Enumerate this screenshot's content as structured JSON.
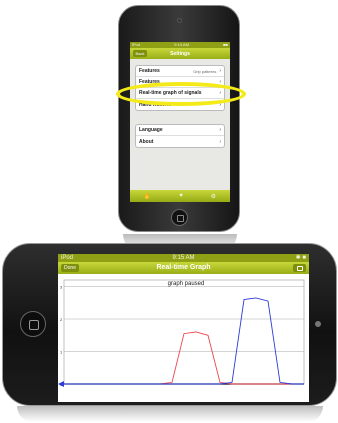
{
  "portrait": {
    "status": {
      "carrier": "iPod",
      "time": "9:14 AM",
      "battery": "■■"
    },
    "navbar": {
      "back": "Back",
      "title": "Settings"
    },
    "group1": [
      {
        "label": "Features",
        "detail": "Grip patterns"
      },
      {
        "label": "Features",
        "detail": ""
      },
      {
        "label": "Real-time graph of signals",
        "detail": ""
      },
      {
        "label": "Hand Actions",
        "detail": ""
      }
    ],
    "group2": [
      {
        "label": "Language",
        "detail": ""
      },
      {
        "label": "About",
        "detail": ""
      }
    ],
    "tabs": [
      "✋",
      "♥",
      "⚙"
    ]
  },
  "landscape": {
    "status": {
      "carrier": "iPod",
      "time": "9:15 AM",
      "battery": "✱ ■"
    },
    "navbar": {
      "done": "Done",
      "title": "Real-time Graph"
    },
    "graph": {
      "annotation": "graph paused",
      "y_ticks": [
        "3",
        "2",
        "1",
        "0"
      ]
    }
  },
  "colors": {
    "accent": "#a8bc1c",
    "highlight": "#f4ea1a",
    "series_red": "#e8474d",
    "series_blue": "#2a3bd8"
  },
  "chart_data": {
    "type": "line",
    "title": "graph paused",
    "ylim": [
      0,
      3.2
    ],
    "y_ticks": [
      0,
      1,
      2,
      3
    ],
    "x": [
      0,
      5,
      10,
      15,
      20,
      25,
      30,
      35,
      40,
      45,
      50,
      55,
      60,
      65,
      70,
      75,
      80,
      85,
      90,
      95,
      100
    ],
    "series": [
      {
        "values": [
          0,
          0,
          0,
          0,
          0,
          0,
          0,
          0,
          0,
          0.05,
          1.55,
          1.6,
          1.5,
          0.05,
          0,
          0,
          0,
          0,
          0,
          0,
          0
        ]
      },
      {
        "values": [
          0,
          0,
          0,
          0,
          0,
          0,
          0,
          0,
          0,
          0,
          0,
          0,
          0,
          0,
          0.05,
          2.6,
          2.65,
          2.55,
          0.05,
          0,
          0
        ]
      }
    ]
  }
}
